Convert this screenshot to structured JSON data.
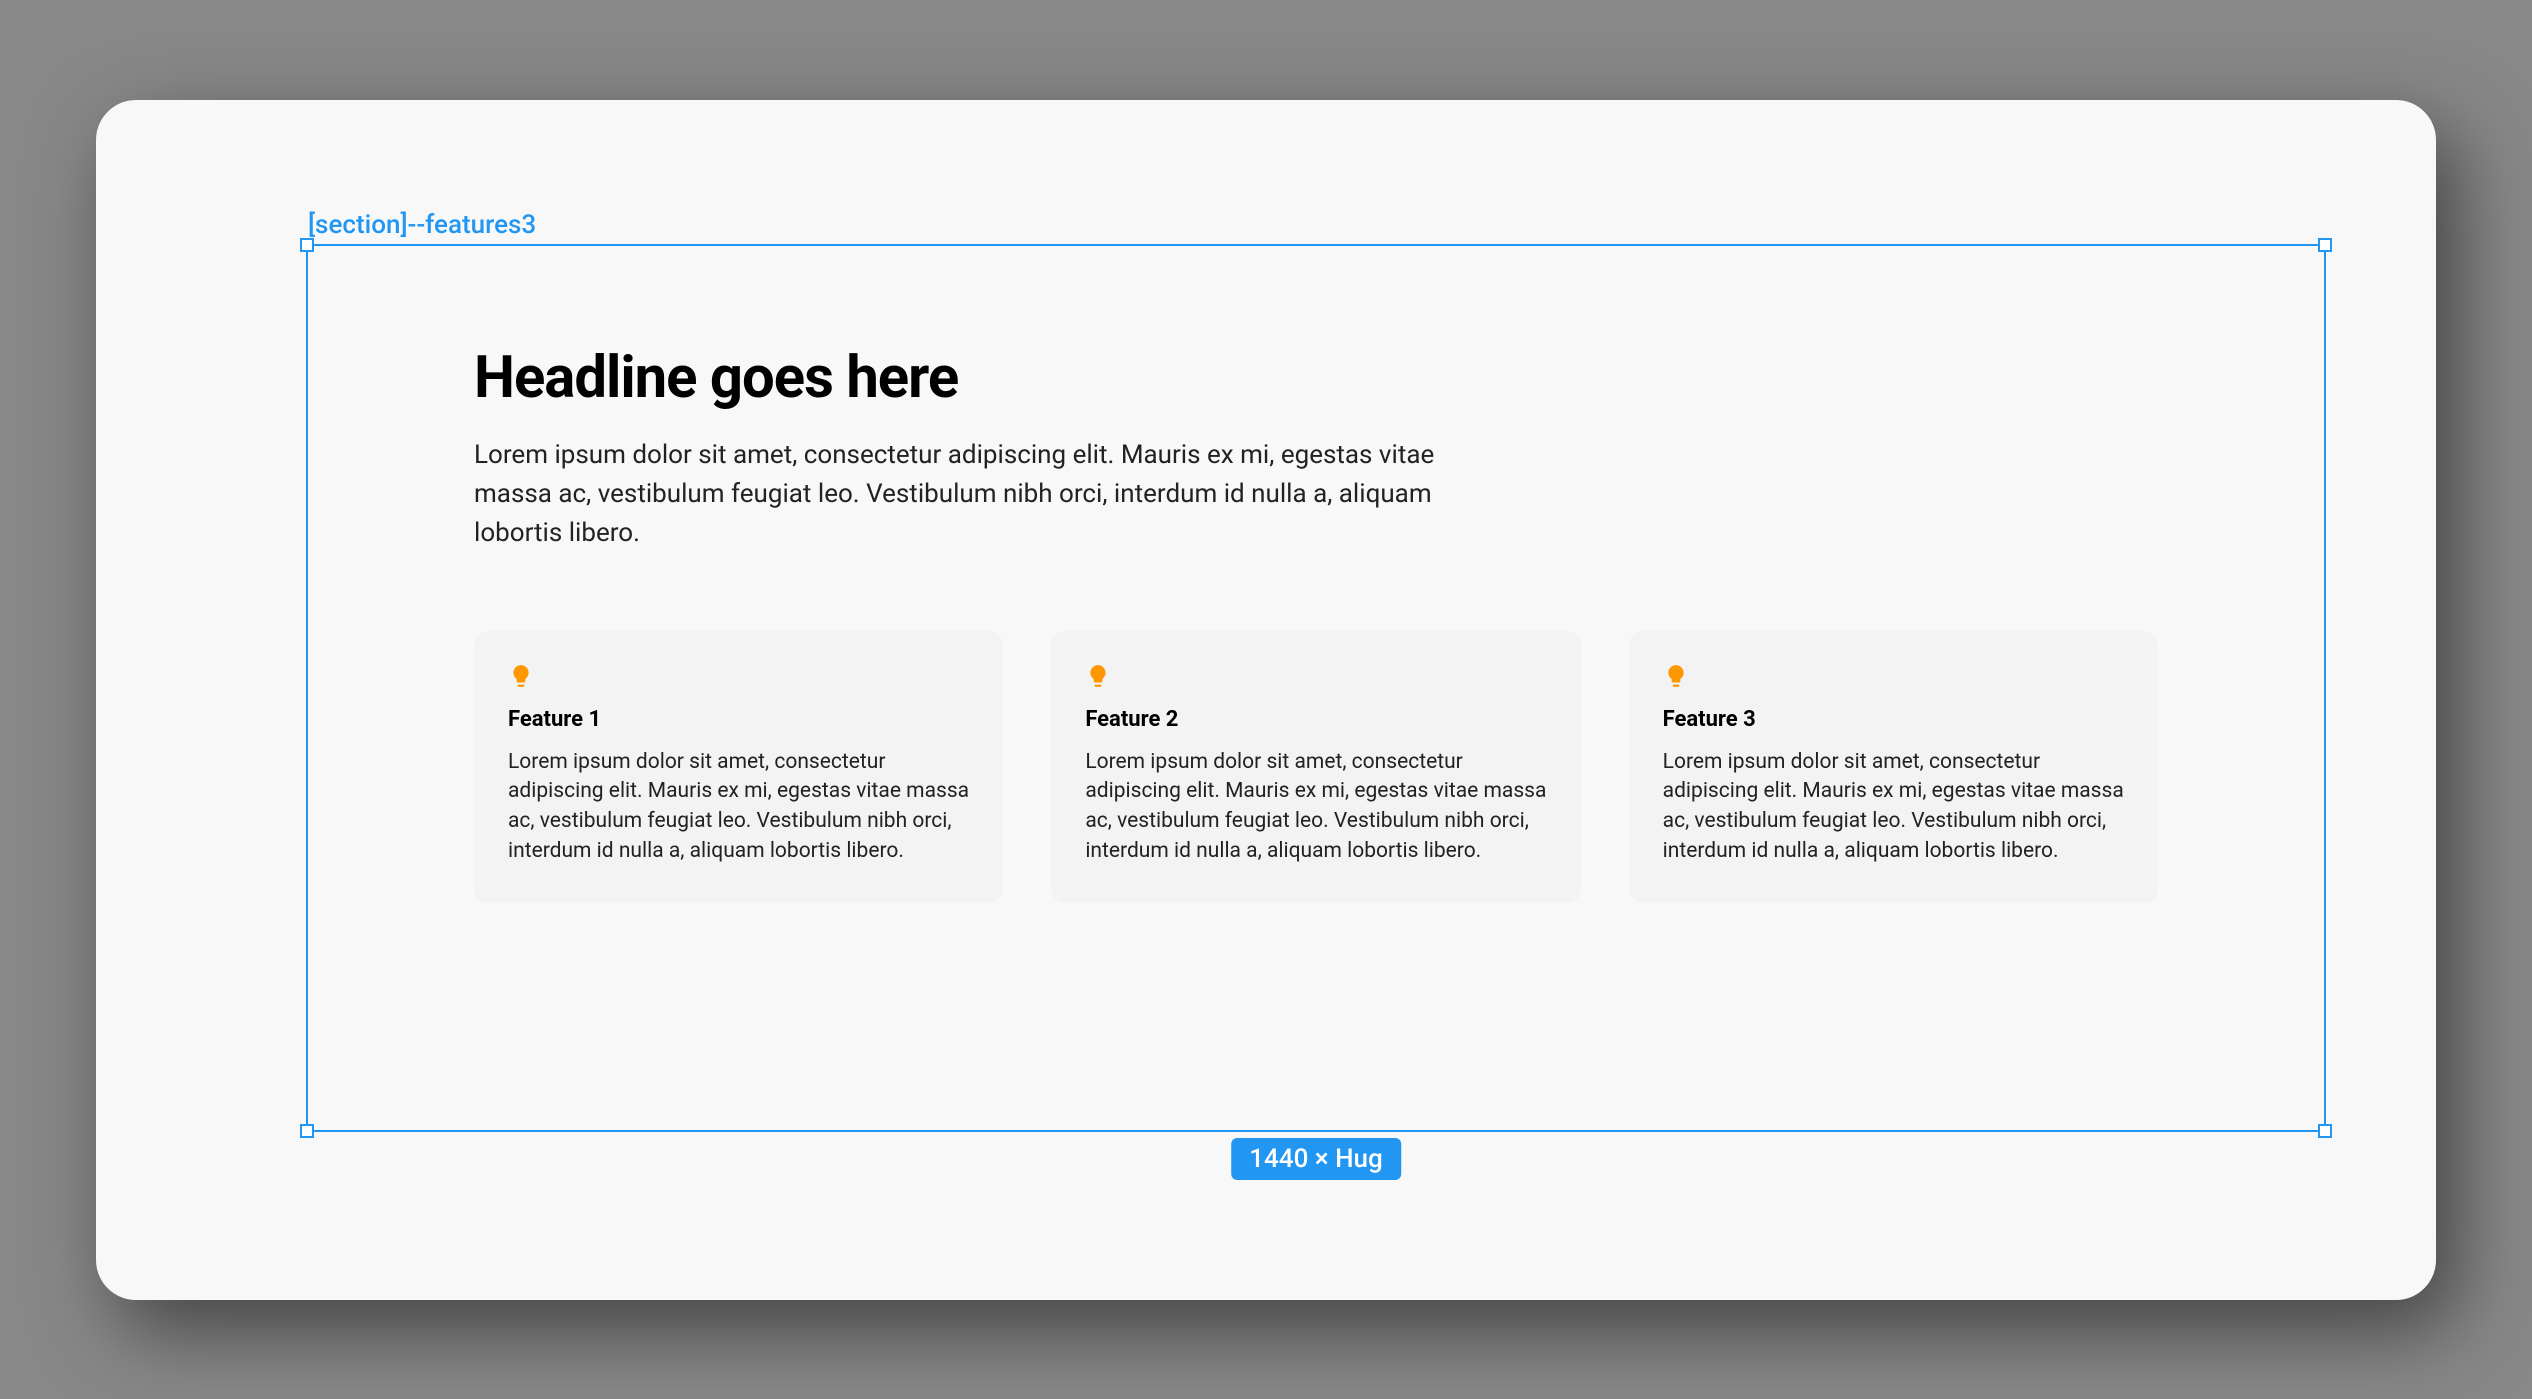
{
  "selection": {
    "label": "[section]--features3",
    "size_badge": "1440 × Hug"
  },
  "section": {
    "headline": "Headline goes here",
    "subheadline": "Lorem ipsum dolor sit amet, consectetur adipiscing elit. Mauris ex mi, egestas vitae massa ac, vestibulum feugiat leo. Vestibulum nibh orci, interdum id nulla a, aliquam lobortis libero.",
    "features": [
      {
        "icon": "lightbulb-icon",
        "title": "Feature 1",
        "desc": "Lorem ipsum dolor sit amet, consectetur adipiscing elit. Mauris ex mi, egestas vitae massa ac, vestibulum feugiat leo. Vestibulum nibh orci, interdum id nulla a, aliquam lobortis libero."
      },
      {
        "icon": "lightbulb-icon",
        "title": "Feature 2",
        "desc": "Lorem ipsum dolor sit amet, consectetur adipiscing elit. Mauris ex mi, egestas vitae massa ac, vestibulum feugiat leo. Vestibulum nibh orci, interdum id nulla a, aliquam lobortis libero."
      },
      {
        "icon": "lightbulb-icon",
        "title": "Feature 3",
        "desc": "Lorem ipsum dolor sit amet, consectetur adipiscing elit. Mauris ex mi, egestas vitae massa ac, vestibulum feugiat leo. Vestibulum nibh orci, interdum id nulla a, aliquam lobortis libero."
      }
    ]
  },
  "colors": {
    "selection": "#2196F3",
    "icon": "#FF9800"
  }
}
